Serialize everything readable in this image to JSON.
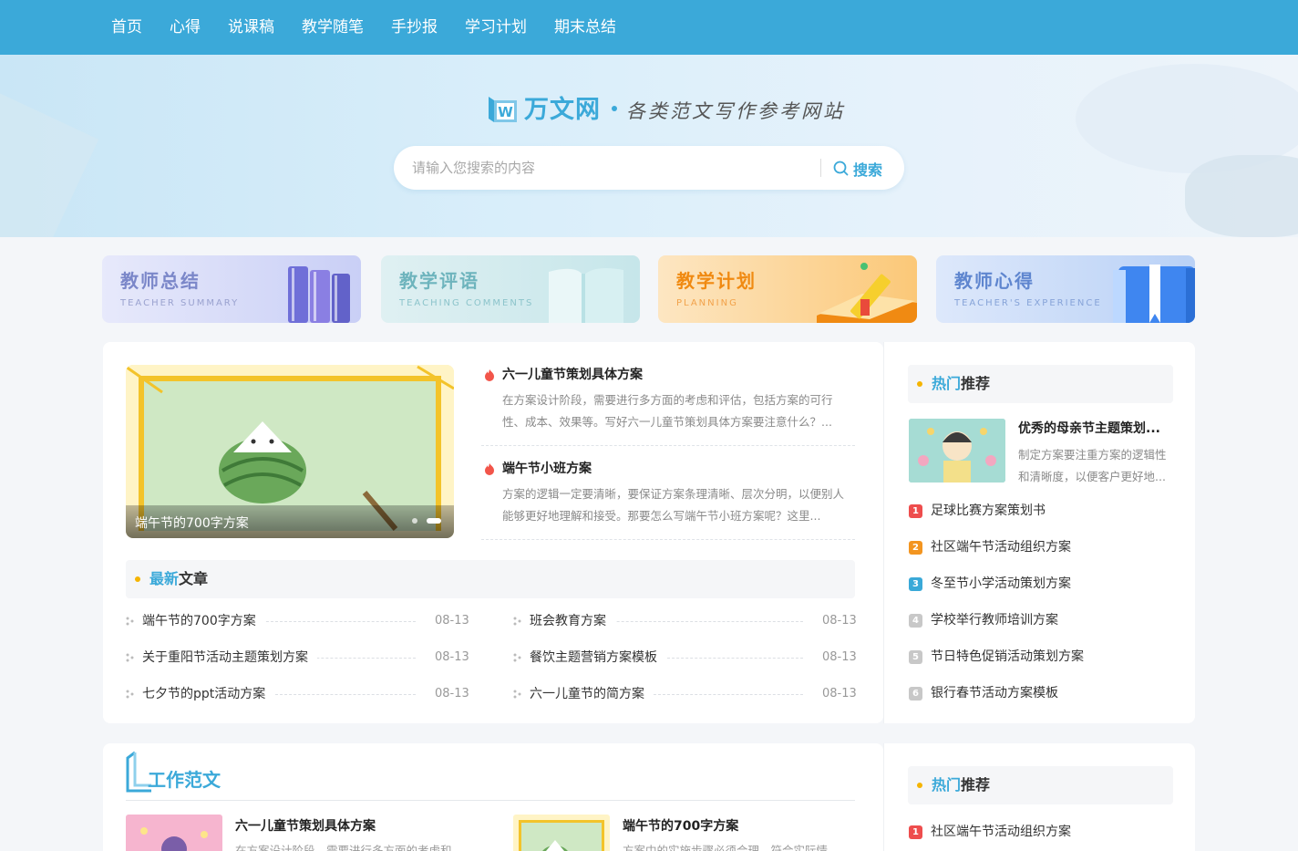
{
  "nav": {
    "items": [
      "首页",
      "心得",
      "说课稿",
      "教学随笔",
      "手抄报",
      "学习计划",
      "期末总结"
    ]
  },
  "brand": {
    "name": "万文网",
    "mark_letter": "W",
    "slogan": "各类范文写作参考网站",
    "accent_color": "#3ba9d9"
  },
  "search": {
    "placeholder": "请输入您搜索的内容",
    "button_label": "搜索"
  },
  "categories": [
    {
      "title": "教师总结",
      "subtitle": "TEACHER SUMMARY"
    },
    {
      "title": "教学评语",
      "subtitle": "TEACHING COMMENTS"
    },
    {
      "title": "教学计划",
      "subtitle": "PLANNING"
    },
    {
      "title": "教师心得",
      "subtitle": "TEACHER'S EXPERIENCE"
    }
  ],
  "slider": {
    "caption": "端午节的700字方案"
  },
  "featured": [
    {
      "title": "六一儿童节策划具体方案",
      "desc": "在方案设计阶段，需要进行多方面的考虑和评估，包括方案的可行性、成本、效果等。写好六一儿童节策划具体方案要注意什么？..."
    },
    {
      "title": "端午节小班方案",
      "desc": "方案的逻辑一定要清晰，要保证方案条理清晰、层次分明，以便别人能够更好地理解和接受。那要怎么写端午节小班方案呢？这里..."
    }
  ],
  "latest": {
    "title_accent": "最新",
    "title_rest": "文章",
    "left": [
      {
        "title": "端午节的700字方案",
        "date": "08-13"
      },
      {
        "title": "关于重阳节活动主题策划方案",
        "date": "08-13"
      },
      {
        "title": "七夕节的ppt活动方案",
        "date": "08-13"
      }
    ],
    "right": [
      {
        "title": "班会教育方案",
        "date": "08-13"
      },
      {
        "title": "餐饮主题营销方案模板",
        "date": "08-13"
      },
      {
        "title": "六一儿童节的简方案",
        "date": "08-13"
      }
    ]
  },
  "hot": {
    "title_accent": "热门",
    "title_rest": "推荐",
    "feature": {
      "title": "优秀的母亲节主题策划...",
      "desc": "制定方案要注重方案的逻辑性和清晰度，以便客户更好地..."
    },
    "ranks": [
      {
        "num": "1",
        "title": "足球比赛方案策划书",
        "color": "#ee4d4d"
      },
      {
        "num": "2",
        "title": "社区端午节活动组织方案",
        "color": "#f39520"
      },
      {
        "num": "3",
        "title": "冬至节小学活动策划方案",
        "color": "#3aa9d8"
      },
      {
        "num": "4",
        "title": "学校举行教师培训方案",
        "color": "#c8c8c8"
      },
      {
        "num": "5",
        "title": "节日特色促销活动策划方案",
        "color": "#c8c8c8"
      },
      {
        "num": "6",
        "title": "银行春节活动方案模板",
        "color": "#c8c8c8"
      }
    ]
  },
  "work": {
    "title": "工作范文",
    "cards": [
      {
        "title": "六一儿童节策划具体方案",
        "desc": "在方案设计阶段，需要进行多方面的考虑和"
      },
      {
        "title": "端午节的700字方案",
        "desc": "方案中的实施步骤必须合理，符合实际情"
      }
    ]
  },
  "hot2": {
    "title_accent": "热门",
    "title_rest": "推荐",
    "ranks": [
      {
        "num": "1",
        "title": "社区端午节活动组织方案",
        "color": "#ee4d4d"
      }
    ]
  }
}
